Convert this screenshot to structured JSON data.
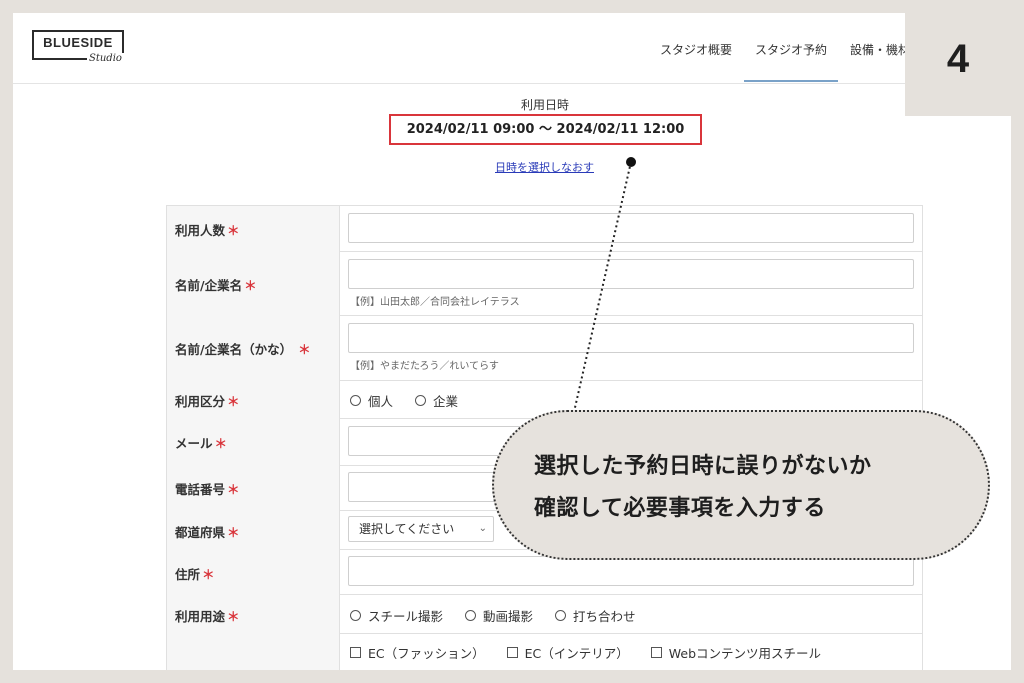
{
  "header": {
    "logo": {
      "main": "BLUESIDE",
      "sub": "Studio"
    },
    "nav": [
      "スタジオ概要",
      "スタジオ予約",
      "設備・機材"
    ]
  },
  "step": {
    "number": "4"
  },
  "datetime": {
    "label": "利用日時",
    "value": "2024/02/11 09:00 〜 2024/02/11 12:00",
    "reselect": "日時を選択しなおす"
  },
  "form": {
    "required_mark": "＊",
    "rows": [
      {
        "label": "利用人数"
      },
      {
        "label": "名前/企業名",
        "hint": "【例】山田太郎／合同会社レイテラス"
      },
      {
        "label": "名前/企業名（かな）",
        "hint": "【例】やまだたろう／れいてらす"
      },
      {
        "label": "利用区分",
        "options": [
          "個人",
          "企業"
        ]
      },
      {
        "label": "メール"
      },
      {
        "label": "電話番号"
      },
      {
        "label": "都道府県",
        "select": "選択してください"
      },
      {
        "label": "住所"
      },
      {
        "label": "利用用途",
        "options": [
          "スチール撮影",
          "動画撮影",
          "打ち合わせ"
        ]
      },
      {
        "label": "",
        "checkboxes": [
          "EC（ファッション）",
          "EC（インテリア）",
          "Webコンテンツ用スチール"
        ]
      }
    ]
  },
  "callout": {
    "line1": "選択した予約日時に誤りがないか",
    "line2": "確認して必要事項を入力する"
  },
  "colors": {
    "highlight": "#d9353b",
    "link": "#2a3bb8",
    "frame": "#e5e1dc"
  }
}
